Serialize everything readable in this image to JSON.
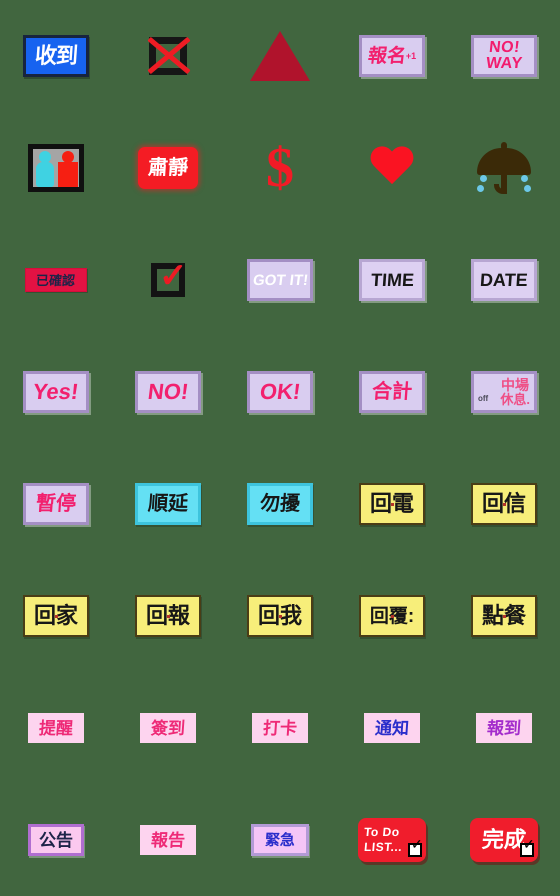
{
  "page": {
    "background_color": "#41663f",
    "grid": {
      "columns": 5,
      "rows": 8
    }
  },
  "palette": {
    "blue_sign": "#1763f0",
    "lavender_sign": "#d9cdf0",
    "cyan_sign": "#64e0f4",
    "yellow_sign": "#f7ee7a",
    "pink_flat": "#fdd4ef",
    "red_sign": "#f01d2c",
    "crimson_sign": "#e31243",
    "magenta_text": "#f2206e",
    "blue_text": "#2a2ecb",
    "purple_text": "#a32ccc",
    "black_text": "#171717",
    "white_text": "#ffffff"
  },
  "stickers": [
    {
      "id": "shoudao",
      "name": "received-sign",
      "text": "收到",
      "style": "blue-plaque",
      "text_color": "#ffffff"
    },
    {
      "id": "x-box",
      "name": "crossed-box-icon",
      "text": "",
      "style": "crossed-box",
      "text_color": "#ee1c24"
    },
    {
      "id": "triangle",
      "name": "red-triangle-icon",
      "text": "",
      "style": "triangle",
      "text_color": "#b0132c"
    },
    {
      "id": "baoming",
      "name": "signup-sign",
      "text": "報名",
      "style": "lavender-plaque",
      "text_color": "#f2206e",
      "superscript": "+1"
    },
    {
      "id": "noway",
      "name": "no-way-sign",
      "text": "NO!WAY",
      "style": "lavender-noway",
      "text_color": "#f21c6e",
      "line1": "NO!",
      "line2": "WAY"
    },
    {
      "id": "restroom",
      "name": "restroom-icon",
      "text": "",
      "style": "restroom",
      "text_color": "#3fd2e2"
    },
    {
      "id": "sujing",
      "name": "silence-sign",
      "text": "肅靜",
      "style": "red-rounded",
      "text_color": "#ffffff"
    },
    {
      "id": "dollar",
      "name": "dollar-sign-icon",
      "text": "$",
      "style": "dollar",
      "text_color": "#f21b26"
    },
    {
      "id": "heart",
      "name": "heart-icon",
      "text": "",
      "style": "heart",
      "text_color": "#fa1322"
    },
    {
      "id": "umbrella",
      "name": "umbrella-rain-icon",
      "text": "",
      "style": "umbrella",
      "text_color": "#3b2a08"
    },
    {
      "id": "yiqueren",
      "name": "confirmed-sign",
      "text": "已確認",
      "style": "crimson-plaque",
      "text_color": "#1d2348"
    },
    {
      "id": "checkbox",
      "name": "checked-box-icon",
      "text": "✓",
      "style": "checkbox",
      "text_color": "#ee1b24"
    },
    {
      "id": "gotit",
      "name": "got-it-sign",
      "text": "GOT IT!",
      "style": "lavender-plaque",
      "text_color": "#ffffff"
    },
    {
      "id": "time",
      "name": "time-sign",
      "text": "TIME",
      "style": "lavender-plaque",
      "text_color": "#171717"
    },
    {
      "id": "date",
      "name": "date-sign",
      "text": "DATE",
      "style": "lavender-plaque",
      "text_color": "#171717"
    },
    {
      "id": "yes",
      "name": "yes-sign",
      "text": "Yes!",
      "style": "lavender-plaque",
      "text_color": "#f2206e"
    },
    {
      "id": "no",
      "name": "no-sign",
      "text": "NO!",
      "style": "lavender-plaque",
      "text_color": "#f2206e"
    },
    {
      "id": "ok",
      "name": "ok-sign",
      "text": "OK!",
      "style": "lavender-plaque",
      "text_color": "#f2206e"
    },
    {
      "id": "heji",
      "name": "total-sign",
      "text": "合計",
      "style": "lavender-plaque",
      "text_color": "#f2206e"
    },
    {
      "id": "zhongchang",
      "name": "intermission-sign",
      "text": "中場休息",
      "style": "break-sign",
      "text_color": "#ef4f86",
      "top": "中場",
      "bottom": "休息.",
      "note": "off"
    },
    {
      "id": "zanting",
      "name": "pause-sign",
      "text": "暫停",
      "style": "lavender-plaque",
      "text_color": "#f2206e"
    },
    {
      "id": "shunyan",
      "name": "postpone-sign",
      "text": "順延",
      "style": "cyan-plaque",
      "text_color": "#171717"
    },
    {
      "id": "wurao",
      "name": "do-not-disturb-sign",
      "text": "勿擾",
      "style": "cyan-plaque",
      "text_color": "#171717"
    },
    {
      "id": "huidian",
      "name": "call-back-sign",
      "text": "回電",
      "style": "yellow-plaque",
      "text_color": "#171717"
    },
    {
      "id": "huixin",
      "name": "reply-letter-sign",
      "text": "回信",
      "style": "yellow-plaque",
      "text_color": "#171717"
    },
    {
      "id": "huijia",
      "name": "go-home-sign",
      "text": "回家",
      "style": "yellow-plaque",
      "text_color": "#171717"
    },
    {
      "id": "huibao",
      "name": "report-back-sign",
      "text": "回報",
      "style": "yellow-plaque",
      "text_color": "#171717"
    },
    {
      "id": "huiwo",
      "name": "reply-to-me-sign",
      "text": "回我",
      "style": "yellow-plaque",
      "text_color": "#171717"
    },
    {
      "id": "huifu",
      "name": "reply-colon-sign",
      "text": "回覆:",
      "style": "yellow-plaque",
      "text_color": "#171717"
    },
    {
      "id": "diancan",
      "name": "order-food-sign",
      "text": "點餐",
      "style": "yellow-plaque",
      "text_color": "#171717"
    },
    {
      "id": "tixing",
      "name": "reminder-sign",
      "text": "提醒",
      "style": "pink-flat",
      "text_color": "#ee2a77"
    },
    {
      "id": "qiandao",
      "name": "sign-in-sign",
      "text": "簽到",
      "style": "pink-flat",
      "text_color": "#ee2a77"
    },
    {
      "id": "daka",
      "name": "clock-in-sign",
      "text": "打卡",
      "style": "pink-flat",
      "text_color": "#ee2a77"
    },
    {
      "id": "tongzhi",
      "name": "notify-sign",
      "text": "通知",
      "style": "pink-flat",
      "text_color": "#2a2ecb"
    },
    {
      "id": "baodao",
      "name": "check-in-sign",
      "text": "報到",
      "style": "pink-flat",
      "text_color": "#a32ccc"
    },
    {
      "id": "gonggao",
      "name": "announcement-sign",
      "text": "公告",
      "style": "pink-framed",
      "text_color": "#1d2348"
    },
    {
      "id": "baogao",
      "name": "report-sign",
      "text": "報告",
      "style": "pink-flat",
      "text_color": "#ee2a77"
    },
    {
      "id": "jinji",
      "name": "urgent-sign",
      "text": "緊急",
      "style": "pink-framed2",
      "text_color": "#2a2ecb"
    },
    {
      "id": "todolist",
      "name": "todo-list-sign",
      "text": "To Do LIST...",
      "style": "red-todo",
      "text_color": "#ffffff",
      "line1": "To Do",
      "line2": "LIST...",
      "check": "✓"
    },
    {
      "id": "wancheng",
      "name": "complete-sign",
      "text": "完成",
      "style": "red-done",
      "text_color": "#ffffff",
      "check": "✓"
    }
  ]
}
